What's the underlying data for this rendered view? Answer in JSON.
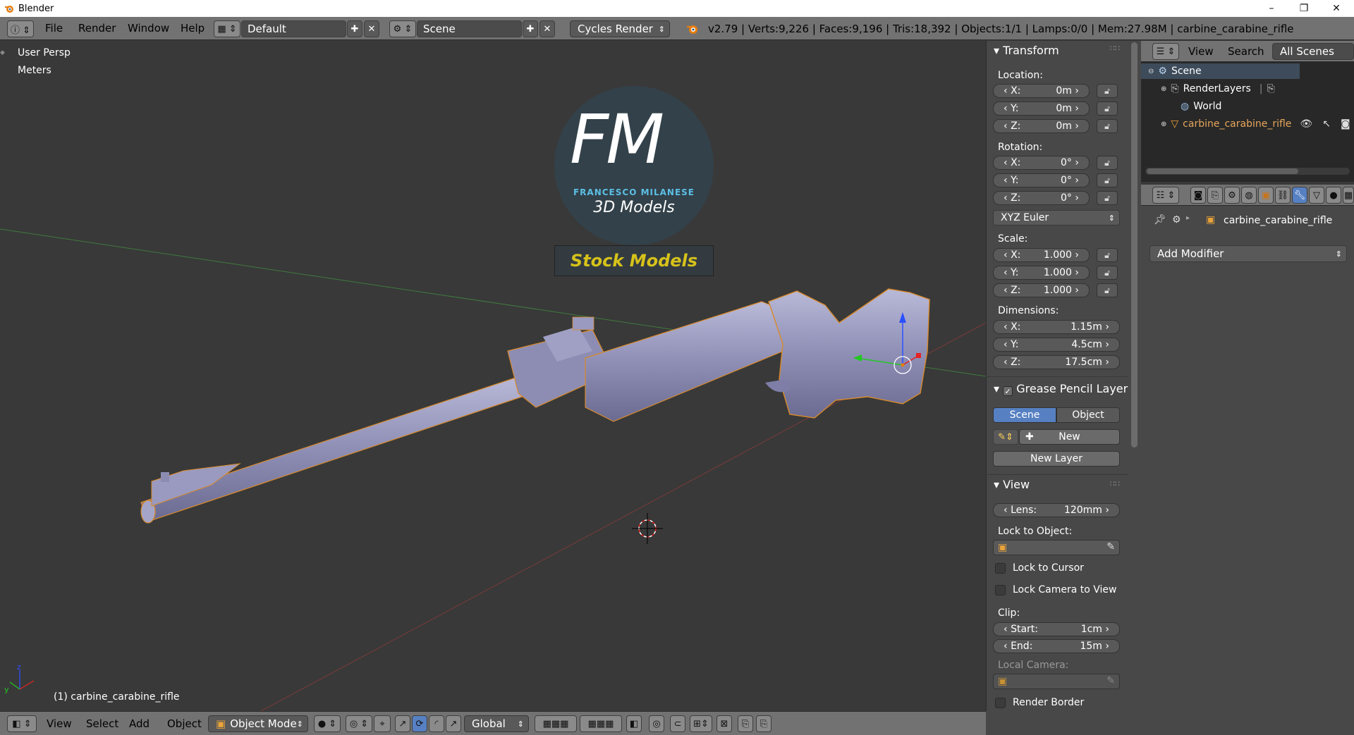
{
  "window": {
    "title": "Blender",
    "minimize": "–",
    "maximize": "❐",
    "close": "✕"
  },
  "header": {
    "menus": [
      "File",
      "Render",
      "Window",
      "Help"
    ],
    "layout": "Default",
    "scene": "Scene",
    "engine": "Cycles Render",
    "info": "v2.79 | Verts:9,226 | Faces:9,196 | Tris:18,392 | Objects:1/1 | Lamps:0/0 | Mem:27.98M | carbine_carabine_rifle"
  },
  "viewport": {
    "view_name": "User Persp",
    "units": "Meters",
    "selected_object": "(1) carbine_carabine_rifle",
    "watermark": {
      "brand": "FM",
      "subtitle": "FRANCESCO MILANESE",
      "tagline": "3D Models",
      "banner": "Stock Models"
    }
  },
  "footer": {
    "menus": [
      "View",
      "Select",
      "Add",
      "Object"
    ],
    "mode": "Object Mode",
    "orientation": "Global"
  },
  "npanel": {
    "transform": {
      "title": "Transform",
      "location_label": "Location:",
      "location": [
        {
          "axis": "X:",
          "value": "0m"
        },
        {
          "axis": "Y:",
          "value": "0m"
        },
        {
          "axis": "Z:",
          "value": "0m"
        }
      ],
      "rotation_label": "Rotation:",
      "rotation": [
        {
          "axis": "X:",
          "value": "0°"
        },
        {
          "axis": "Y:",
          "value": "0°"
        },
        {
          "axis": "Z:",
          "value": "0°"
        }
      ],
      "rotation_mode": "XYZ Euler",
      "scale_label": "Scale:",
      "scale": [
        {
          "axis": "X:",
          "value": "1.000"
        },
        {
          "axis": "Y:",
          "value": "1.000"
        },
        {
          "axis": "Z:",
          "value": "1.000"
        }
      ],
      "dimensions_label": "Dimensions:",
      "dimensions": [
        {
          "axis": "X:",
          "value": "1.15m"
        },
        {
          "axis": "Y:",
          "value": "4.5cm"
        },
        {
          "axis": "Z:",
          "value": "17.5cm"
        }
      ]
    },
    "grease_pencil": {
      "title": "Grease Pencil Layer",
      "tab_scene": "Scene",
      "tab_object": "Object",
      "new_label": "New",
      "new_layer_label": "New Layer"
    },
    "view": {
      "title": "View",
      "lens_label": "Lens:",
      "lens_value": "120mm",
      "lock_to_object_label": "Lock to Object:",
      "lock_to_cursor": "Lock to Cursor",
      "lock_camera": "Lock Camera to View",
      "clip_label": "Clip:",
      "clip_start_label": "Start:",
      "clip_start": "1cm",
      "clip_end_label": "End:",
      "clip_end": "15m",
      "local_camera_label": "Local Camera:",
      "render_border": "Render Border"
    }
  },
  "outliner": {
    "header": {
      "view": "View",
      "search": "Search",
      "filter": "All Scenes"
    },
    "items": [
      {
        "label": "Scene"
      },
      {
        "label": "RenderLayers"
      },
      {
        "label": "World"
      },
      {
        "label": "carbine_carabine_rifle"
      }
    ]
  },
  "properties": {
    "object_name": "carbine_carabine_rifle",
    "add_modifier": "Add Modifier"
  }
}
